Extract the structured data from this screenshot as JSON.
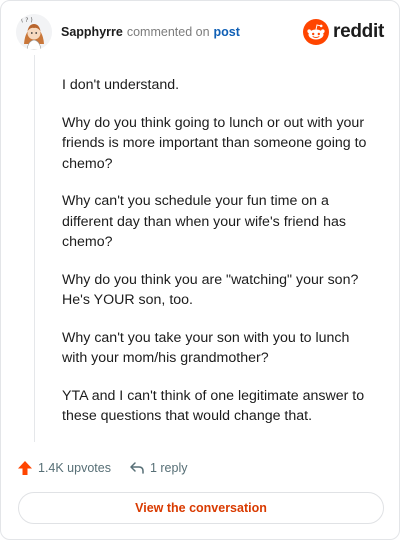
{
  "header": {
    "author": "Sapphyrre",
    "verb": "commented on",
    "post_link": "post",
    "brand": "reddit"
  },
  "comment": {
    "paragraphs": [
      "I don't understand.",
      "Why do you think going to lunch or out with your friends is more important than someone going to chemo?",
      "Why can't you schedule your fun time on a different day than when your wife's friend has chemo?",
      "Why do you think you are \"watching\" your son? He's YOUR son, too.",
      "Why can't you take your son with you to lunch with your mom/his grandmother?",
      "YTA and I can't think of one legitimate answer to these questions that would change that."
    ]
  },
  "actions": {
    "upvotes": "1.4K upvotes",
    "replies": "1 reply"
  },
  "cta": {
    "label": "View the conversation"
  },
  "colors": {
    "brand_orange": "#ff4500",
    "upvote": "#ff4500",
    "cta_text": "#d93a00",
    "link": "#0f5fb5"
  }
}
